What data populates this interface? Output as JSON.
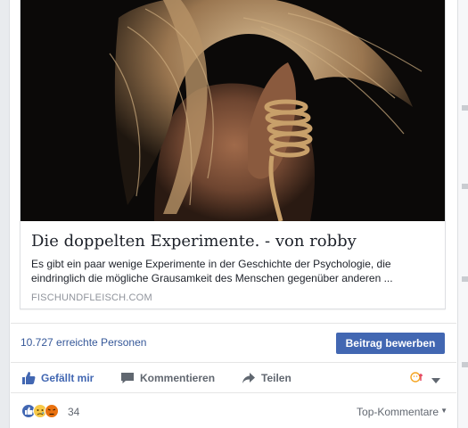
{
  "link_preview": {
    "image": "photo-woman-long-hair-tied-wrists-rope",
    "title": "Die doppelten Experimente. - von robby",
    "description": "Es gibt ein paar wenige Experimente in der Geschichte der Psychologie, die eindringlich die mögliche Grausamkeit des Menschen gegenüber anderen ...",
    "domain": "FISCHUNDFLEISCH.COM"
  },
  "insights": {
    "reach_text": "10.727 erreichte Personen",
    "boost_label": "Beitrag bewerben"
  },
  "actions": {
    "like_label": "Gefällt mir",
    "comment_label": "Kommentieren",
    "share_label": "Teilen"
  },
  "reactions": {
    "icons": [
      "like-icon",
      "sad-icon",
      "angry-icon"
    ],
    "count": "34",
    "sort_label": "Top-Kommentare"
  },
  "colors": {
    "facebook_blue": "#4267b2",
    "link_blue": "#365899",
    "muted_text": "#616770"
  }
}
